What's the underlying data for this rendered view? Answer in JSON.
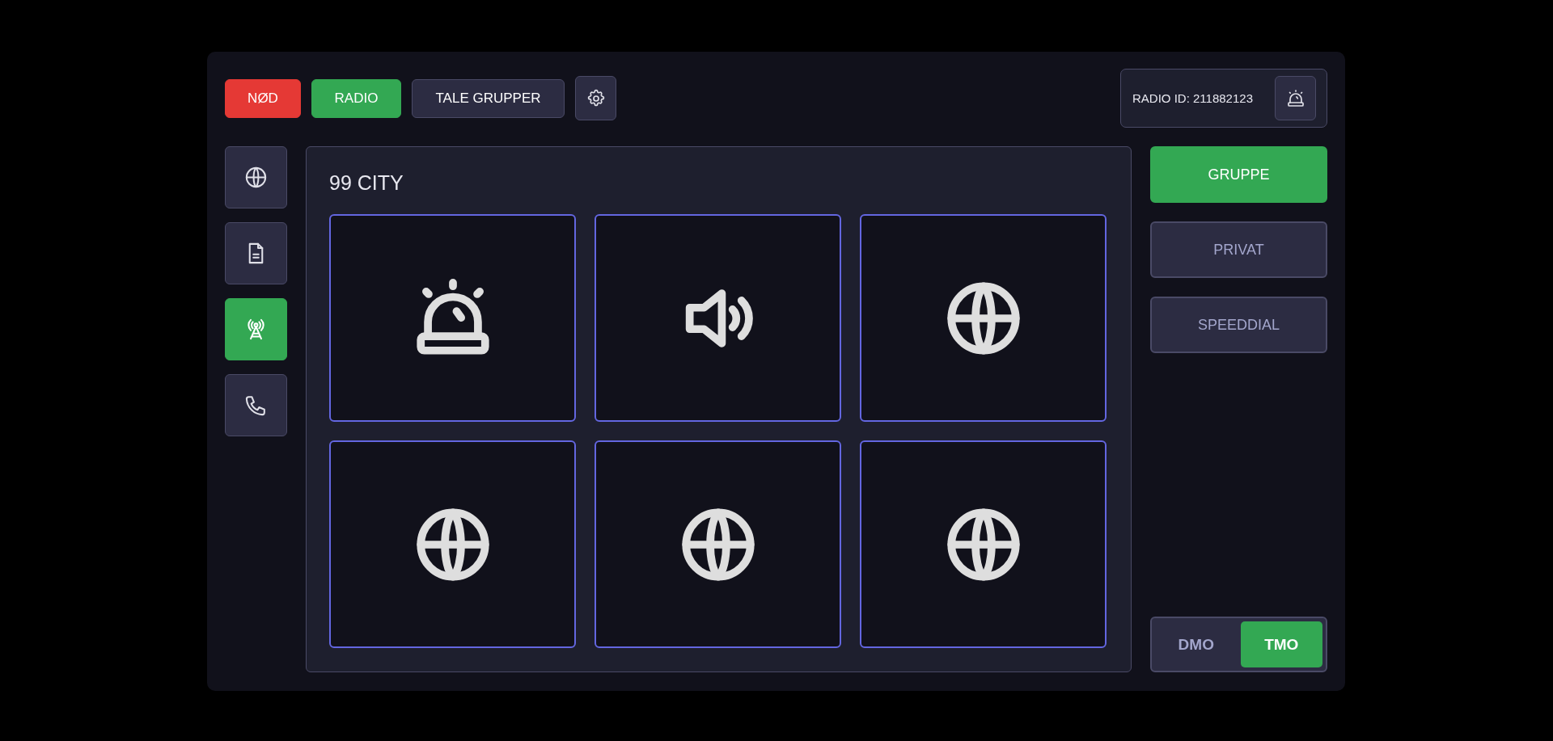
{
  "top_buttons": [
    {
      "label": "NØD",
      "kind": "danger"
    },
    {
      "label": "RADIO",
      "kind": "success"
    },
    {
      "label": "TALE GRUPPER",
      "kind": "plain"
    },
    {
      "kind": "settings"
    }
  ],
  "radio_id": {
    "label": "RADIO ID: 211882123"
  },
  "sidebar": {
    "items": [
      {
        "kind": "globe",
        "selected": false
      },
      {
        "kind": "document",
        "selected": false
      },
      {
        "kind": "antenna",
        "selected": true
      },
      {
        "kind": "phone",
        "selected": false
      }
    ]
  },
  "group": {
    "title": "99 CITY",
    "tiles": [
      {
        "kind": "alarm"
      },
      {
        "kind": "speaker"
      },
      {
        "kind": "globe"
      },
      {
        "kind": "globe"
      },
      {
        "kind": "globe"
      },
      {
        "kind": "globe"
      }
    ]
  },
  "modes": [
    {
      "label": "GRUPPE",
      "selected": true
    },
    {
      "label": "PRIVAT",
      "selected": false
    },
    {
      "label": "SPEEDDIAL",
      "selected": false
    }
  ],
  "network_toggle": [
    {
      "label": "DMO",
      "selected": false
    },
    {
      "label": "TMO",
      "selected": true
    }
  ]
}
